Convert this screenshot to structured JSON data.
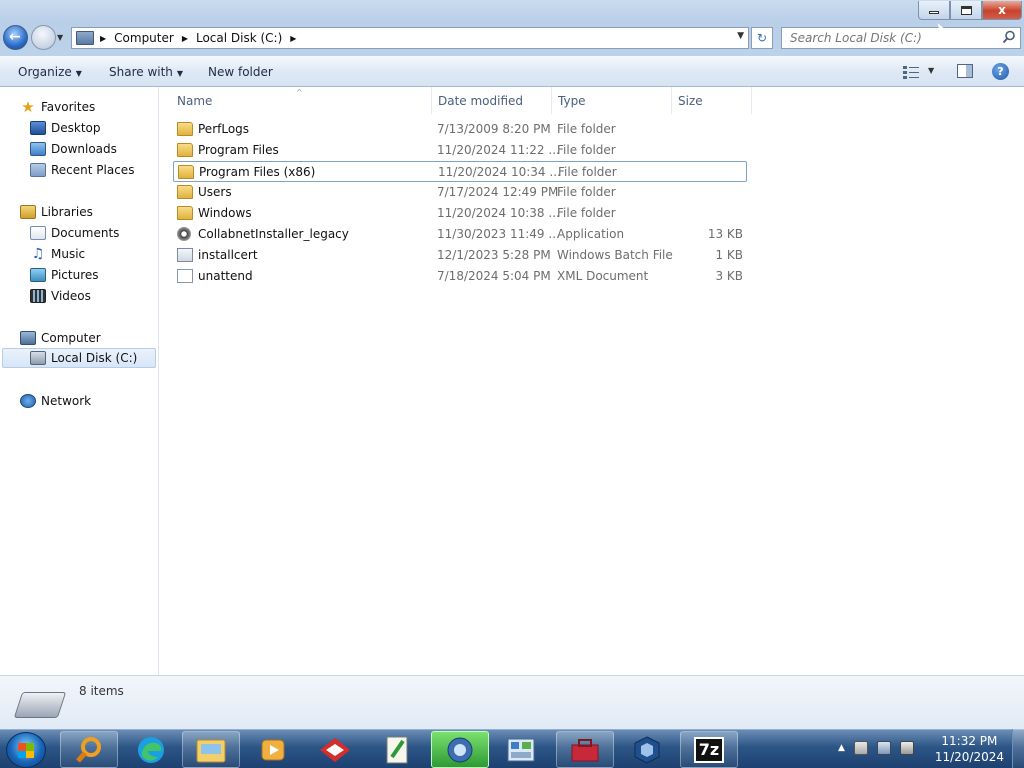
{
  "window": {
    "minimize_label": "",
    "maximize_label": "",
    "close_label": "x"
  },
  "address_bar": {
    "crumbs": [
      "Computer",
      "Local Disk (C:)"
    ]
  },
  "search": {
    "placeholder": "Search Local Disk (C:)"
  },
  "toolbar": {
    "organize_label": "Organize",
    "share_label": "Share with",
    "new_folder_label": "New folder"
  },
  "nav": {
    "favorites": "Favorites",
    "desktop": "Desktop",
    "downloads": "Downloads",
    "recent_places": "Recent Places",
    "libraries": "Libraries",
    "documents": "Documents",
    "music": "Music",
    "pictures": "Pictures",
    "videos": "Videos",
    "computer": "Computer",
    "local_disk": "Local Disk (C:)",
    "network": "Network"
  },
  "columns": {
    "name": "Name",
    "date": "Date modified",
    "type": "Type",
    "size": "Size"
  },
  "files": [
    {
      "name": "PerfLogs",
      "date": "7/13/2009 8:20 PM",
      "type": "File folder",
      "size": ""
    },
    {
      "name": "Program Files",
      "date": "11/20/2024 11:22 ...",
      "type": "File folder",
      "size": ""
    },
    {
      "name": "Program Files (x86)",
      "date": "11/20/2024 10:34 ...",
      "type": "File folder",
      "size": ""
    },
    {
      "name": "Users",
      "date": "7/17/2024 12:49 PM",
      "type": "File folder",
      "size": ""
    },
    {
      "name": "Windows",
      "date": "11/20/2024 10:38 ...",
      "type": "File folder",
      "size": ""
    },
    {
      "name": "CollabnetInstaller_legacy",
      "date": "11/30/2023 11:49 ...",
      "type": "Application",
      "size": "13 KB"
    },
    {
      "name": "installcert",
      "date": "12/1/2023 5:28 PM",
      "type": "Windows Batch File",
      "size": "1 KB"
    },
    {
      "name": "unattend",
      "date": "7/18/2024 5:04 PM",
      "type": "XML Document",
      "size": "3 KB"
    }
  ],
  "status": {
    "item_count": "8 items"
  },
  "taskbar": {
    "apps": [
      "search-app",
      "edge",
      "windows-explorer",
      "media-player",
      "red-app",
      "notepad-plus",
      "network-app",
      "control-panel",
      "toolbox-app",
      "virtualbox",
      "7-zip"
    ],
    "seven_zip_label": "7z",
    "time": "11:32 PM",
    "date": "11/20/2024"
  }
}
